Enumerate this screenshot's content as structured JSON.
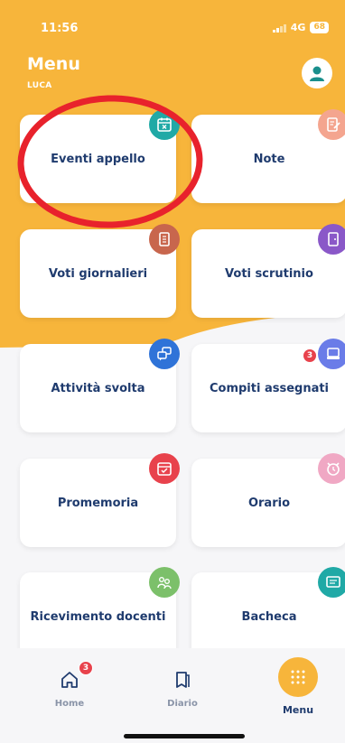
{
  "status_bar": {
    "time": "11:56",
    "network": "4G",
    "battery": "68"
  },
  "header": {
    "title": "Menu",
    "user": "LUCA"
  },
  "colors": {
    "accent": "#f7b53b",
    "label": "#1f3b6e",
    "annotation": "#e8222c"
  },
  "menu_items": [
    {
      "label": "Eventi appello",
      "icon": "calendar-x-icon",
      "color": "#20a9a6"
    },
    {
      "label": "Note",
      "icon": "note-edit-icon",
      "color": "#f4a58f"
    },
    {
      "label": "Voti giornalieri",
      "icon": "grades-book-icon",
      "color": "#c8664d"
    },
    {
      "label": "Voti scrutinio",
      "icon": "door-icon",
      "color": "#8a58c8"
    },
    {
      "label": "Attività svolta",
      "icon": "chat-bubbles-icon",
      "color": "#2f73d8"
    },
    {
      "label": "Compiti assegnati",
      "icon": "homework-icon",
      "color": "#6a7ce8",
      "badge": "3"
    },
    {
      "label": "Promemoria",
      "icon": "calendar-check-icon",
      "color": "#e8424c"
    },
    {
      "label": "Orario",
      "icon": "alarm-clock-icon",
      "color": "#f0a8c4"
    },
    {
      "label": "Ricevimento docenti",
      "icon": "teachers-icon",
      "color": "#7cc06a"
    },
    {
      "label": "Bacheca",
      "icon": "board-icon",
      "color": "#20a9a6"
    }
  ],
  "tabs": [
    {
      "label": "Home",
      "icon": "home-icon",
      "badge": "3"
    },
    {
      "label": "Diario",
      "icon": "diary-icon"
    },
    {
      "label": "Menu",
      "icon": "grid-icon",
      "active": true
    }
  ]
}
